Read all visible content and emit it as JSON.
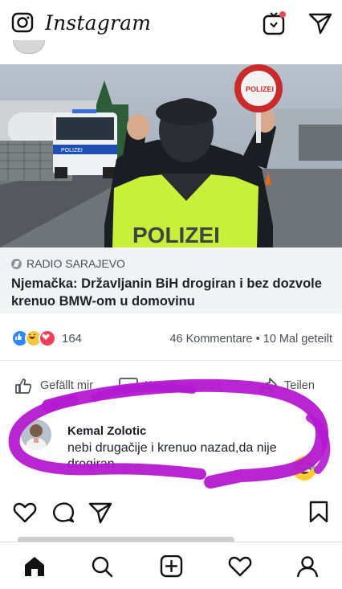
{
  "app": {
    "title": "Instagram"
  },
  "link": {
    "source": "RADIO SARAJEVO",
    "headline": "Njemačka: Državljanin BiH drogiran i bez dozvole krenuo BMW-om u domovinu"
  },
  "stats": {
    "reactions_count": "164",
    "comments_shares": "46 Kommentare • 10 Mal geteilt"
  },
  "fb_actions": {
    "like": "Gefällt mir",
    "comment": "Kommentieren",
    "share": "Teilen"
  },
  "comment": {
    "author": "Kemal Zolotic",
    "text": "nebi drugačije i krenuo nazad,da nije drogiran"
  },
  "photo_text": {
    "vest": "POLIZEI",
    "sign": "POLIZEI",
    "car": "POLIZEI"
  },
  "icons": {
    "top": [
      "camera-icon",
      "igtv-icon",
      "send-icon"
    ],
    "post_actions": [
      "heart-icon",
      "comment-icon",
      "share-icon",
      "bookmark-icon"
    ],
    "bottom_nav": [
      "home-icon",
      "search-icon",
      "add-post-icon",
      "activity-heart-icon",
      "profile-icon"
    ]
  },
  "colors": {
    "accent_blue": "#2d88ff",
    "scribble": "#b41ad0",
    "notification": "#ed4956"
  }
}
